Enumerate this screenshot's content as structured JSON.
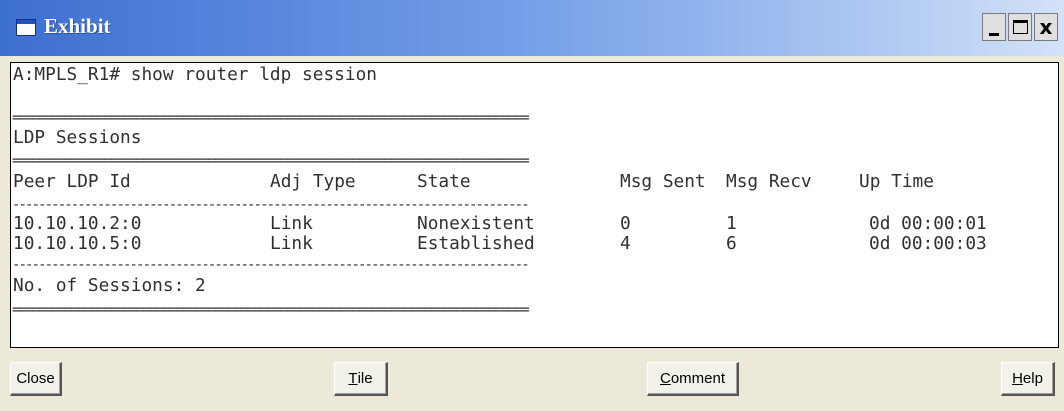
{
  "window": {
    "title": "Exhibit",
    "controls": {
      "minimize": "_",
      "maximize": "□",
      "close": "x"
    }
  },
  "console": {
    "command_line": "A:MPLS_R1# show router ldp session",
    "double_rule": "===============================================================================",
    "single_rule": "-------------------------------------------------------------------------------",
    "section_title": "LDP Sessions",
    "columns": [
      "Peer LDP Id",
      "Adj Type",
      "State",
      "Msg Sent",
      "Msg Recv",
      "Up Time"
    ],
    "rows": [
      {
        "peer": "10.10.10.2:0",
        "adj_type": "Link",
        "state": "Nonexistent",
        "msg_sent": "0",
        "msg_recv": "1",
        "up_time": "0d 00:00:01"
      },
      {
        "peer": "10.10.10.5:0",
        "adj_type": "Link",
        "state": "Established",
        "msg_sent": "4",
        "msg_recv": "6",
        "up_time": "0d 00:00:03"
      }
    ],
    "summary": "No. of Sessions: 2"
  },
  "buttons": {
    "close": "Close",
    "tile_mnemonic": "T",
    "tile_rest": "ile",
    "comment_mnemonic": "C",
    "comment_rest": "omment",
    "help_mnemonic": "H",
    "help_rest": "elp"
  }
}
